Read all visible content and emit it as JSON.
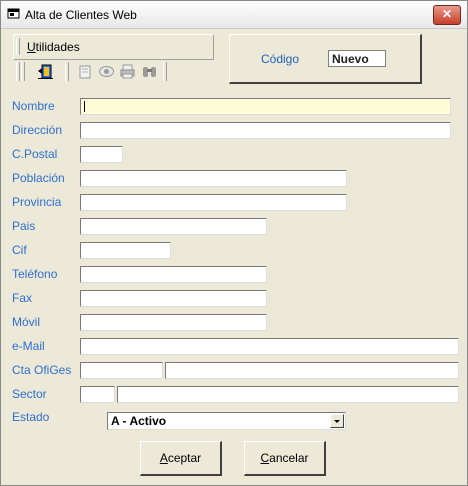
{
  "window": {
    "title": "Alta de Clientes Web",
    "close_glyph": "✕"
  },
  "menu": {
    "utilidades_first": "U",
    "utilidades_rest": "tilidades"
  },
  "code": {
    "label": "Código",
    "value": "Nuevo"
  },
  "toolbar": {
    "icons": [
      "exit-door-icon",
      "document-icon",
      "eye-icon",
      "print-icon",
      "binoculars-icon"
    ]
  },
  "form": {
    "nombre": {
      "label": "Nombre",
      "value": ""
    },
    "direccion": {
      "label": "Dirección",
      "value": ""
    },
    "cpostal": {
      "label": "C.Postal",
      "value": ""
    },
    "poblacion": {
      "label": "Población",
      "value": ""
    },
    "provincia": {
      "label": "Provincia",
      "value": ""
    },
    "pais": {
      "label": "Pais",
      "value": ""
    },
    "cif": {
      "label": "Cif",
      "value": ""
    },
    "telefono": {
      "label": "Teléfono",
      "value": ""
    },
    "fax": {
      "label": "Fax",
      "value": ""
    },
    "movil": {
      "label": "Móvil",
      "value": ""
    },
    "email": {
      "label": "e-Mail",
      "value": ""
    },
    "cta_ofiges": {
      "label": "Cta OfiGes",
      "value_code": "",
      "value_desc": ""
    },
    "sector": {
      "label": "Sector",
      "value_code": "",
      "value_desc": ""
    },
    "estado": {
      "label": "Estado",
      "value": "A - Activo"
    }
  },
  "buttons": {
    "aceptar_first": "A",
    "aceptar_rest": "ceptar",
    "cancelar_first": "C",
    "cancelar_rest": "ancelar"
  },
  "colors": {
    "label": "#2f6fcf",
    "highlight_field": "#fffdd8",
    "window_bg": "#ece9d8"
  }
}
